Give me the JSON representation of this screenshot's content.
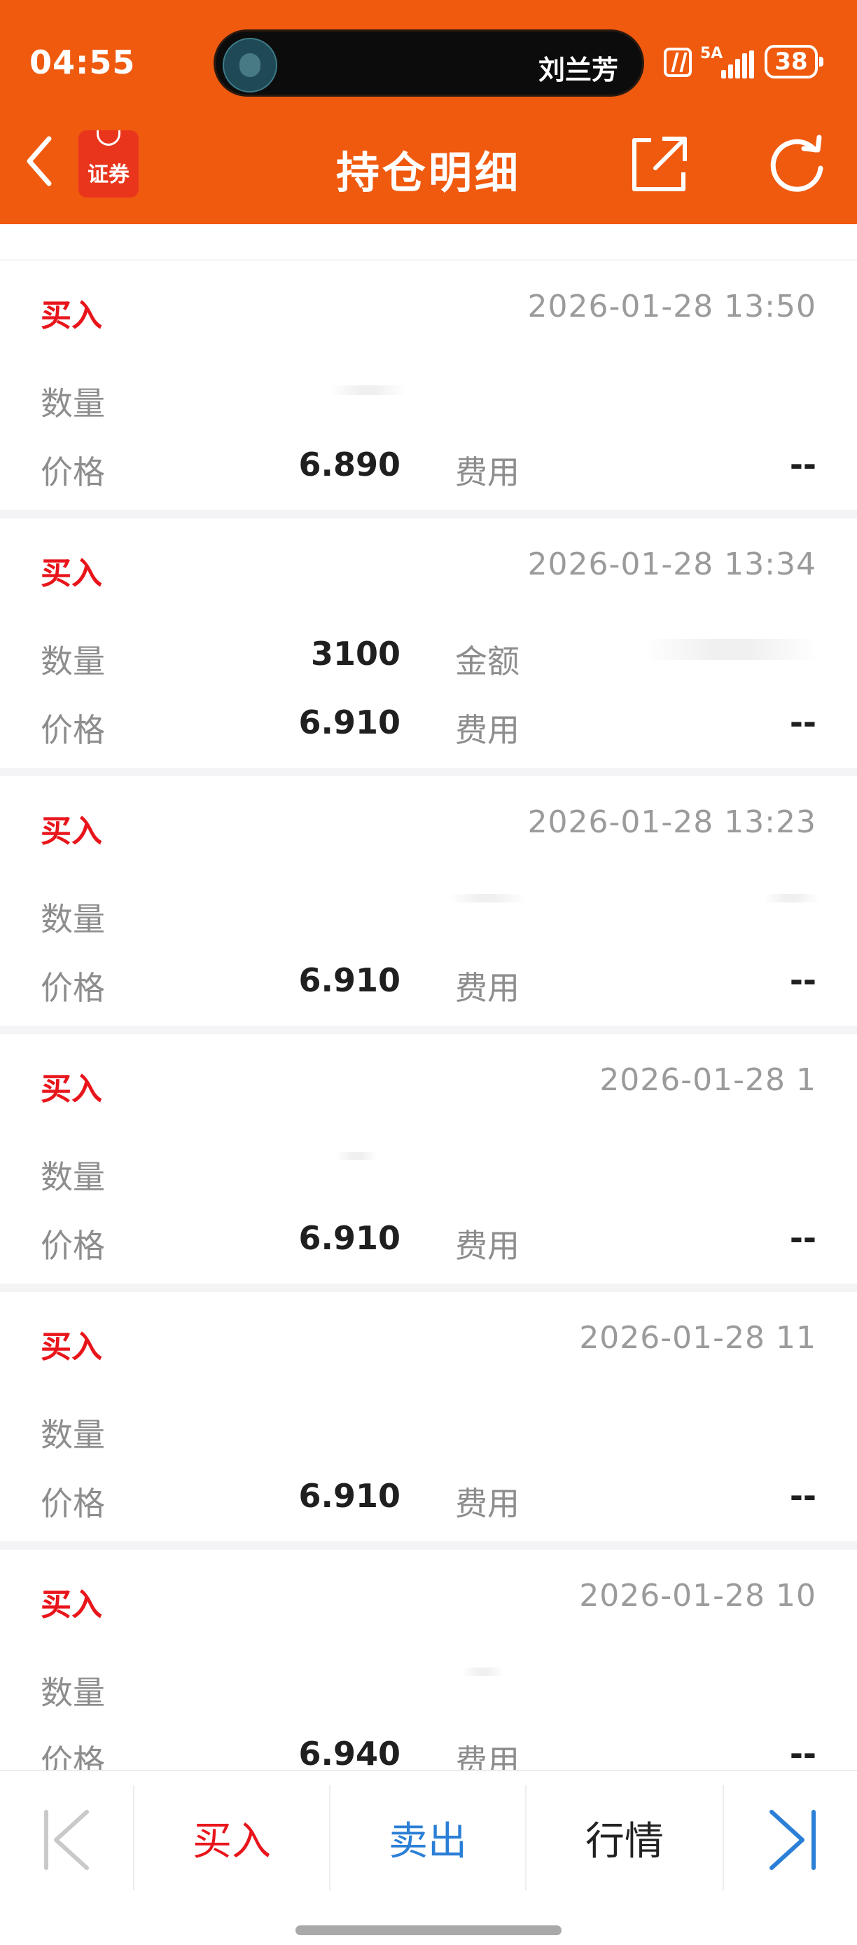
{
  "status_bar": {
    "time": "04:55",
    "island_text": "刘兰芳",
    "network": "5A",
    "battery": "38"
  },
  "header": {
    "title": "持仓明细",
    "logo_text": "证券",
    "brand_color": "#f05a0f"
  },
  "labels": {
    "quantity": "数量",
    "price": "价格",
    "amount": "金额",
    "fee": "费用"
  },
  "records": [
    {
      "type": "买入",
      "time": "2026-01-28 13:50",
      "quantity": "",
      "price": "6.890",
      "amount": "",
      "fee": "--"
    },
    {
      "type": "买入",
      "time": "2026-01-28 13:34",
      "quantity": "3100",
      "price": "6.910",
      "amount": "",
      "fee": "--"
    },
    {
      "type": "买入",
      "time": "2026-01-28 13:23",
      "quantity": "",
      "price": "6.910",
      "amount": "",
      "fee": "--"
    },
    {
      "type": "买入",
      "time": "2026-01-28 1",
      "quantity": "",
      "price": "6.910",
      "amount": "",
      "fee": "--"
    },
    {
      "type": "买入",
      "time": "2026-01-28 11",
      "quantity": "",
      "price": "6.910",
      "amount": "",
      "fee": "--"
    },
    {
      "type": "买入",
      "time": "2026-01-28 10",
      "quantity": "",
      "price": "6.940",
      "amount": "",
      "fee": "--"
    }
  ],
  "bottom_bar": {
    "buy": "买入",
    "sell": "卖出",
    "quote": "行情",
    "buy_color": "#e8151b",
    "sell_color": "#2b7fd6",
    "quote_color": "#222222"
  },
  "icons": [
    "back-icon",
    "share-icon",
    "refresh-icon",
    "first-page-icon",
    "last-page-icon",
    "nfc-icon",
    "signal-icon",
    "battery-icon"
  ]
}
